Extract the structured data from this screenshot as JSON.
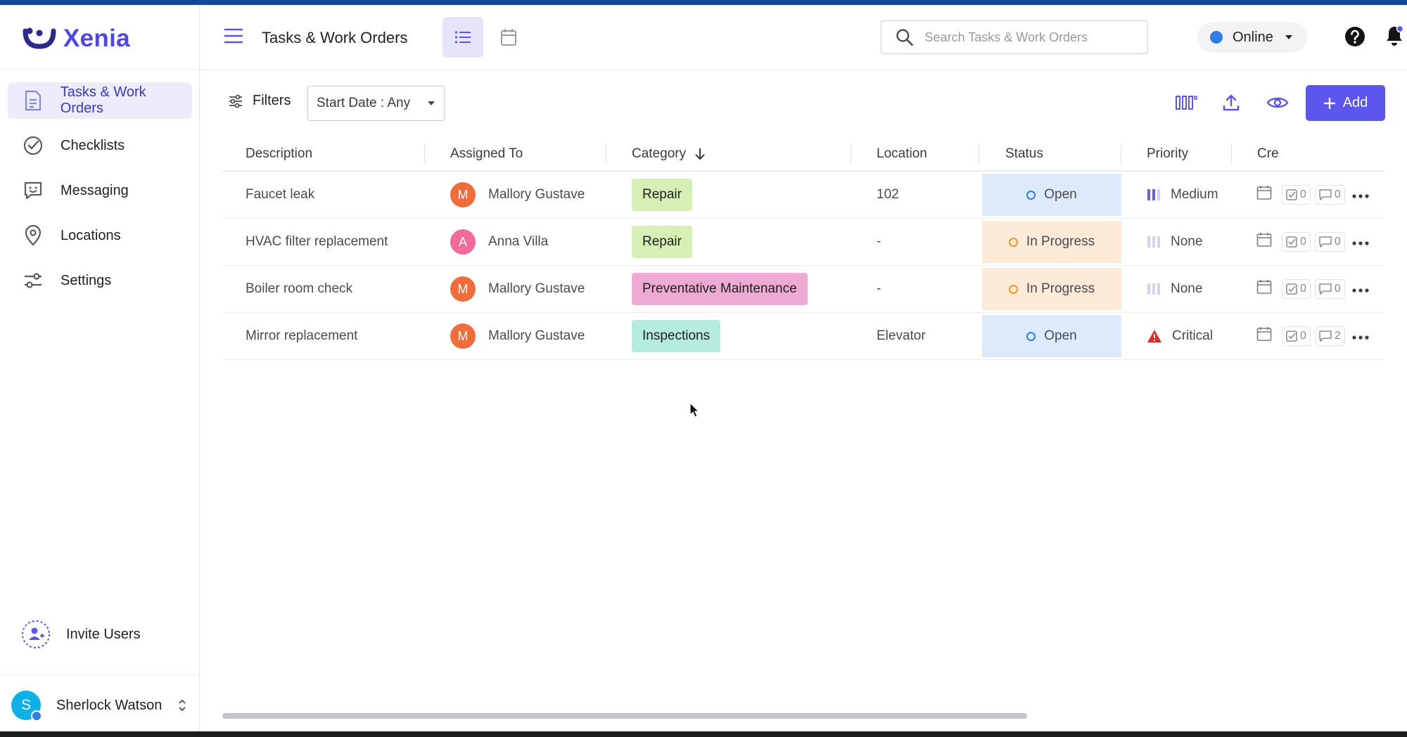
{
  "brand": {
    "name": "Xenia",
    "color": "#4e48e0"
  },
  "sidebar": {
    "items": [
      {
        "label": "Tasks & Work Orders",
        "icon": "document-icon",
        "active": true
      },
      {
        "label": "Checklists",
        "icon": "check-circle-icon",
        "active": false
      },
      {
        "label": "Messaging",
        "icon": "chat-smile-icon",
        "active": false
      },
      {
        "label": "Locations",
        "icon": "map-pin-icon",
        "active": false
      },
      {
        "label": "Settings",
        "icon": "sliders-icon",
        "active": false
      }
    ],
    "invite_label": "Invite Users",
    "user": {
      "initial": "S",
      "name": "Sherlock Watson"
    }
  },
  "header": {
    "title": "Tasks & Work Orders",
    "search_placeholder": "Search Tasks & Work Orders",
    "status_label": "Online",
    "status_color": "#2e7de0"
  },
  "toolbar": {
    "filters_label": "Filters",
    "date_filter": "Start Date : Any",
    "add_label": "Add"
  },
  "table": {
    "columns": [
      "Description",
      "Assigned To",
      "Category",
      "Location",
      "Status",
      "Priority",
      "Cre"
    ],
    "rows": [
      {
        "description": "Faucet leak",
        "assignee_initial": "M",
        "assignee": "Mallory Gustave",
        "assignee_color": "#f06c3a",
        "category": "Repair",
        "category_color": "#d6efb5",
        "location": "102",
        "status": "Open",
        "status_bg": "#dceafb",
        "status_ring": "#2e7de0",
        "priority": "Medium",
        "priority_icon": "priority-medium-icon",
        "checks": "0",
        "comments": "0"
      },
      {
        "description": "HVAC filter replacement",
        "assignee_initial": "A",
        "assignee": "Anna Villa",
        "assignee_color": "#f06a9a",
        "category": "Repair",
        "category_color": "#d6efb5",
        "location": "-",
        "status": "In Progress",
        "status_bg": "#fdead7",
        "status_ring": "#f09a2a",
        "priority": "None",
        "priority_icon": "priority-none-icon",
        "checks": "0",
        "comments": "0"
      },
      {
        "description": "Boiler room check",
        "assignee_initial": "M",
        "assignee": "Mallory Gustave",
        "assignee_color": "#f06c3a",
        "category": "Preventative Maintenance",
        "category_color": "#eeaad2",
        "location": "-",
        "status": "In Progress",
        "status_bg": "#fdead7",
        "status_ring": "#f09a2a",
        "priority": "None",
        "priority_icon": "priority-none-icon",
        "checks": "0",
        "comments": "0"
      },
      {
        "description": "Mirror replacement",
        "assignee_initial": "M",
        "assignee": "Mallory Gustave",
        "assignee_color": "#f06c3a",
        "category": "Inspections",
        "category_color": "#b5ecdf",
        "location": "Elevator",
        "status": "Open",
        "status_bg": "#dceafb",
        "status_ring": "#2e7de0",
        "priority": "Critical",
        "priority_icon": "warning-triangle-icon",
        "checks": "0",
        "comments": "2"
      }
    ]
  },
  "colors": {
    "accent": "#5c56ee",
    "active_nav_bg": "#ececfb"
  }
}
